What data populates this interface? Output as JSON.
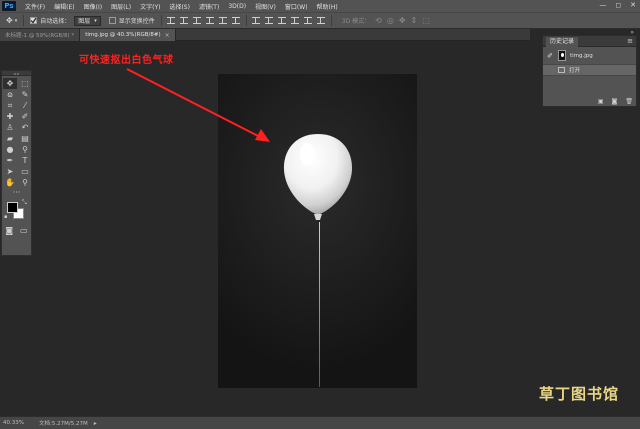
{
  "app": {
    "logo": "Ps"
  },
  "menu": [
    "文件(F)",
    "编辑(E)",
    "图像(I)",
    "图层(L)",
    "文字(Y)",
    "选择(S)",
    "滤镜(T)",
    "3D(D)",
    "视图(V)",
    "窗口(W)",
    "帮助(H)"
  ],
  "window_controls": {
    "minimize": "—",
    "maximize": "◻",
    "close": "✕"
  },
  "options": {
    "auto_select_label": "自动选择：",
    "auto_select_checked": true,
    "layer_select_value": "图层",
    "show_transform_label": "显示变换控件",
    "show_transform_checked": false,
    "mode_3d_label": "3D 模式："
  },
  "tabs": [
    {
      "label": "未标题-1 @ 59%(RGB/8) *",
      "active": false
    },
    {
      "label": "timg.jpg @ 40.3%(RGB/8#)",
      "active": true
    }
  ],
  "annotation": {
    "text": "可快速抠出白色气球",
    "color": "#ff2020"
  },
  "history": {
    "title": "历史记录",
    "snapshot_label": "timg.jpg",
    "steps": [
      {
        "label": "打开"
      }
    ]
  },
  "status": {
    "zoom": "40.33%",
    "doc_size": "文档:5.27M/5.27M"
  },
  "watermark": "草丁图书馆"
}
